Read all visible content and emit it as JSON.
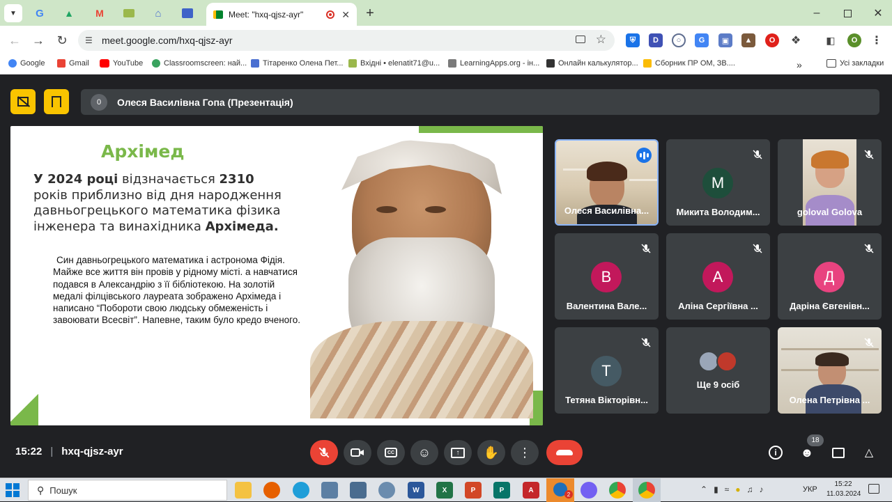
{
  "browser": {
    "tab_title": "Meet: \"hxq-qjsz-ayr\"",
    "url": "meet.google.com/hxq-qjsz-ayr",
    "profile_initial": "O",
    "bookmarks": [
      {
        "label": "Google",
        "color": "#4285f4"
      },
      {
        "label": "Gmail",
        "color": "#ea4335"
      },
      {
        "label": "YouTube",
        "color": "#ff0000"
      },
      {
        "label": "Classroomscreen: най...",
        "color": "#3aa35f"
      },
      {
        "label": "Тітаренко Олена Пет...",
        "color": "#4a6fd1"
      },
      {
        "label": "Вхідні • elenatit71@u...",
        "color": "#9bb84c"
      },
      {
        "label": "LearningApps.org - ін...",
        "color": "#7a7a7a"
      },
      {
        "label": "Онлайн калькулятор...",
        "color": "#333333"
      },
      {
        "label": "Сборник ПР ОМ, ЗВ....",
        "color": "#fbbc04"
      }
    ],
    "all_bookmarks": "Усі закладки"
  },
  "meet": {
    "presenter_count": "0",
    "presenter_label": "Олеся Василівна Гопа (Презентація)",
    "slide": {
      "title": "Архімед",
      "lead_parts": [
        "У 2024 році",
        " відзначається ",
        "2310",
        " років приблизно від дня народження давньогрецького математика фізика інженера та винахідника ",
        "Архімеда."
      ],
      "body": "Син давньогрецького математика і астронома Фідія. Майже все життя він провів у рідному місті. а навчатися подався в Александрію з її бібліотекою. На золотій медалі філцівського лауреата зображено Архімеда і написано “Побороти свою людську обмеженість і завоювати Всесвіт”. Напевне, таким було кредо вченого."
    },
    "participants": [
      {
        "name": "Олеся Василівна...",
        "initial": "",
        "color": "",
        "video": true,
        "speaking": true
      },
      {
        "name": "Микита Володим...",
        "initial": "М",
        "color": "#1e4e3b",
        "video": false,
        "speaking": false
      },
      {
        "name": "goloval Golova",
        "initial": "",
        "color": "",
        "video": true,
        "speaking": false
      },
      {
        "name": "Валентина Вале...",
        "initial": "В",
        "color": "#c2185b",
        "video": false,
        "speaking": false
      },
      {
        "name": "Аліна Сергіївна ...",
        "initial": "А",
        "color": "#c2185b",
        "video": false,
        "speaking": false
      },
      {
        "name": "Даріна Євгенівн...",
        "initial": "Д",
        "color": "#e8437f",
        "video": false,
        "speaking": false
      },
      {
        "name": "Тетяна Вікторівн...",
        "initial": "Т",
        "color": "#455a64",
        "video": false,
        "speaking": false
      },
      {
        "name": "Ще 9 осіб",
        "initial": "",
        "color": "",
        "video": false,
        "speaking": false
      },
      {
        "name": "Олена Петрівна ...",
        "initial": "",
        "color": "",
        "video": true,
        "speaking": false
      }
    ],
    "time": "15:22",
    "meeting_code": "hxq-qjsz-ayr",
    "people_count": "18"
  },
  "taskbar": {
    "search_placeholder": "Пошук",
    "lang": "УКР",
    "clock_time": "15:22",
    "clock_date": "11.03.2024",
    "notif_count": "2"
  }
}
